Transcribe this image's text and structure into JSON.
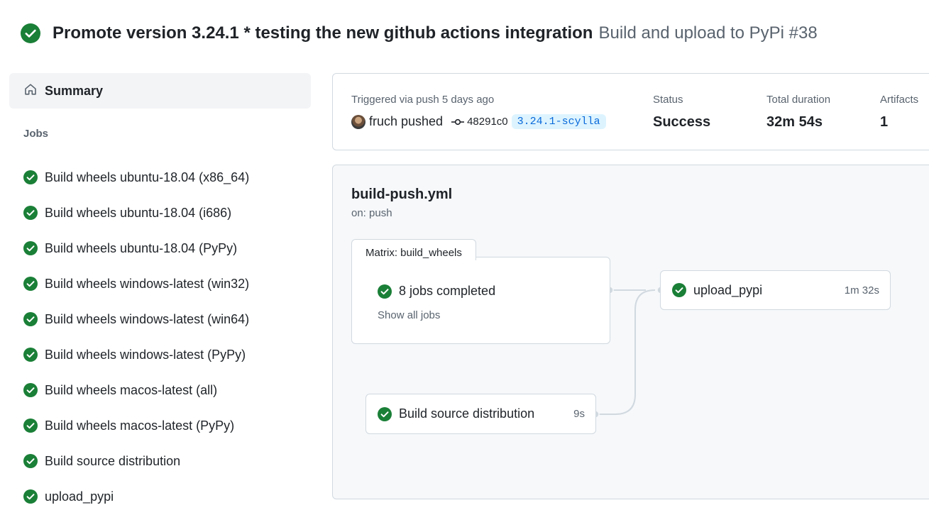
{
  "header": {
    "title": "Promote version 3.24.1 * testing the new github actions integration",
    "subtitle": "Build and upload to PyPi #38"
  },
  "sidebar": {
    "summary_label": "Summary",
    "jobs_heading": "Jobs",
    "jobs": [
      {
        "label": "Build wheels ubuntu-18.04 (x86_64)",
        "status": "success"
      },
      {
        "label": "Build wheels ubuntu-18.04 (i686)",
        "status": "success"
      },
      {
        "label": "Build wheels ubuntu-18.04 (PyPy)",
        "status": "success"
      },
      {
        "label": "Build wheels windows-latest (win32)",
        "status": "success"
      },
      {
        "label": "Build wheels windows-latest (win64)",
        "status": "success"
      },
      {
        "label": "Build wheels windows-latest (PyPy)",
        "status": "success"
      },
      {
        "label": "Build wheels macos-latest (all)",
        "status": "success"
      },
      {
        "label": "Build wheels macos-latest (PyPy)",
        "status": "success"
      },
      {
        "label": "Build source distribution",
        "status": "success"
      },
      {
        "label": "upload_pypi",
        "status": "success"
      }
    ]
  },
  "run_summary": {
    "trigger": "Triggered via push 5 days ago",
    "pusher": "fruch pushed",
    "commit": "48291c0",
    "branch": "3.24.1-scylla",
    "status_label": "Status",
    "status_value": "Success",
    "duration_label": "Total duration",
    "duration_value": "32m 54s",
    "artifacts_label": "Artifacts",
    "artifacts_value": "1"
  },
  "workflow": {
    "file": "build-push.yml",
    "trigger": "on: push",
    "matrix_tab": "Matrix: build_wheels",
    "matrix_status": "8 jobs completed",
    "show_all": "Show all jobs",
    "nodes": {
      "upload": {
        "label": "upload_pypi",
        "duration": "1m 32s"
      },
      "source": {
        "label": "Build source distribution",
        "duration": "9s"
      }
    }
  },
  "colors": {
    "success": "#1a7f37",
    "link": "#0969da",
    "muted": "#59636e",
    "border": "#d1d9e0"
  },
  "icons": {
    "status": "check-circle-icon",
    "summary": "home-icon",
    "commit": "git-commit-icon"
  }
}
